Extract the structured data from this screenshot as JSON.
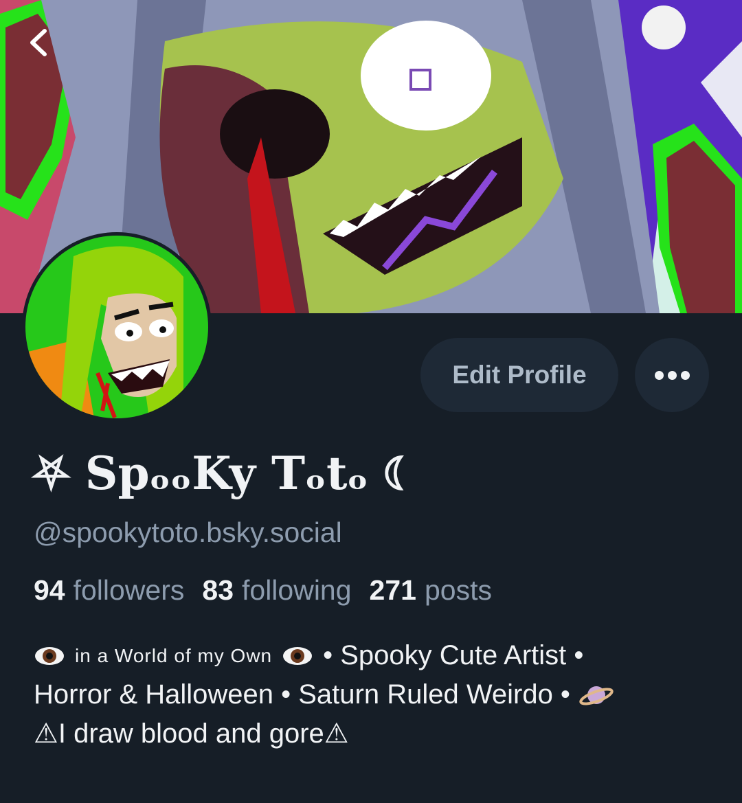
{
  "profile": {
    "display_name": "⛧ SpₒₒKy Tₒtₒ ☾",
    "handle": "@spookytoto.bsky.social",
    "edit_label": "Edit Profile",
    "more_icon": "more-horizontal-icon",
    "back_icon": "chevron-left-icon"
  },
  "stats": {
    "followers_count": "94",
    "followers_label": "followers",
    "following_count": "83",
    "following_label": "following",
    "posts_count": "271",
    "posts_label": "posts"
  },
  "bio": {
    "line1_text": "in a World of my Own",
    "line1_suffix": "• Spooky Cute Artist •",
    "line2": "Horror & Halloween  • Saturn Ruled Weirdo •",
    "line3": "⚠I draw blood and gore⚠"
  },
  "colors": {
    "background": "#161e27",
    "button_bg": "#1e2936",
    "text_primary": "#f1f3f5",
    "text_secondary": "#8d9cae"
  }
}
